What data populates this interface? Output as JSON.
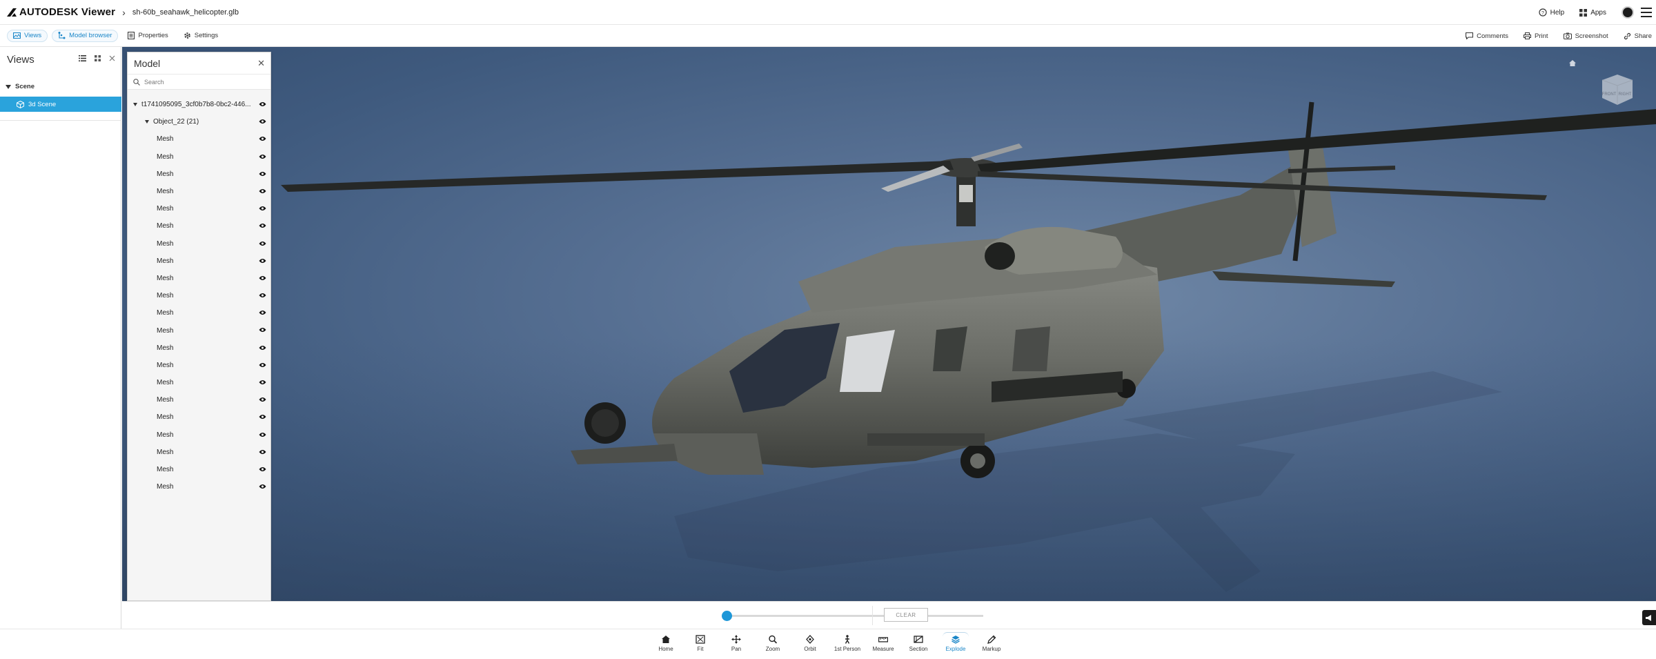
{
  "header": {
    "brand": "AUTODESK Viewer",
    "filename": "sh-60b_seahawk_helicopter.glb",
    "help_label": "Help",
    "apps_label": "Apps"
  },
  "toolbar": {
    "views_label": "Views",
    "model_browser_label": "Model browser",
    "properties_label": "Properties",
    "settings_label": "Settings",
    "comments_label": "Comments",
    "print_label": "Print",
    "screenshot_label": "Screenshot",
    "share_label": "Share"
  },
  "views_panel": {
    "title": "Views",
    "section": "Scene",
    "items": [
      {
        "label": "3d Scene",
        "selected": true
      }
    ]
  },
  "model_panel": {
    "title": "Model",
    "search_placeholder": "Search",
    "root": "t1741095095_3cf0b7b8-0bc2-446...",
    "object": "Object_22 (21)",
    "meshes": [
      "Mesh",
      "Mesh",
      "Mesh",
      "Mesh",
      "Mesh",
      "Mesh",
      "Mesh",
      "Mesh",
      "Mesh",
      "Mesh",
      "Mesh",
      "Mesh",
      "Mesh",
      "Mesh",
      "Mesh",
      "Mesh",
      "Mesh",
      "Mesh",
      "Mesh",
      "Mesh",
      "Mesh"
    ]
  },
  "explode": {
    "value": 0,
    "clear_label": "CLEAR"
  },
  "nav_cube": {
    "front_label": "FRONT",
    "right_label": "RIGHT"
  },
  "bottom_toolbar": {
    "items": [
      {
        "label": "Home",
        "icon": "home-icon"
      },
      {
        "label": "Fit",
        "icon": "fit-icon"
      },
      {
        "label": "Pan",
        "icon": "pan-icon"
      },
      {
        "label": "Zoom",
        "icon": "zoom-icon"
      },
      {
        "label": "Orbit",
        "icon": "orbit-icon"
      },
      {
        "label": "1st Person",
        "icon": "first-person-icon"
      },
      {
        "label": "Measure",
        "icon": "measure-icon"
      },
      {
        "label": "Section",
        "icon": "section-icon"
      },
      {
        "label": "Explode",
        "icon": "explode-icon",
        "active": true
      },
      {
        "label": "Markup",
        "icon": "markup-icon"
      }
    ]
  },
  "colors": {
    "accent": "#2aa3dc",
    "viewport_bg": "#566f92"
  }
}
